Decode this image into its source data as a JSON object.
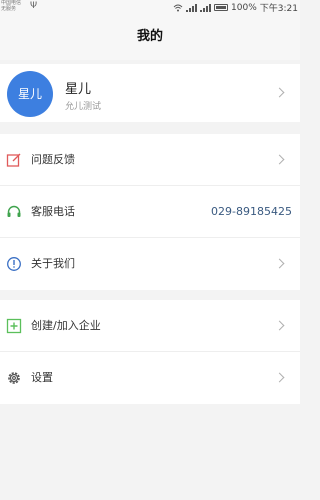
{
  "status_bar": {
    "carrier_line1": "中国电信",
    "carrier_line2": "无服务",
    "usb_symbol": "Ψ",
    "battery": "100%",
    "time": "下午3:21"
  },
  "header": {
    "title": "我的"
  },
  "profile": {
    "avatar_text": "星儿",
    "name": "星儿",
    "subtitle": "允儿测试"
  },
  "menu": {
    "feedback": {
      "label": "问题反馈",
      "icon": "edit-icon",
      "color": "#e05a5a"
    },
    "service": {
      "label": "客服电话",
      "value": "029-89185425",
      "icon": "headset-icon",
      "color": "#3fa34d"
    },
    "about": {
      "label": "关于我们",
      "icon": "info-icon",
      "color": "#3a6fc4"
    },
    "enterprise": {
      "label": "创建/加入企业",
      "icon": "add-square-icon",
      "color": "#5bbf5b"
    },
    "settings": {
      "label": "设置",
      "icon": "gear-icon",
      "color": "#555555"
    }
  },
  "colors": {
    "accent": "#3d7fe0",
    "phone_text": "#3a5a80",
    "background": "#f3f3f3"
  }
}
